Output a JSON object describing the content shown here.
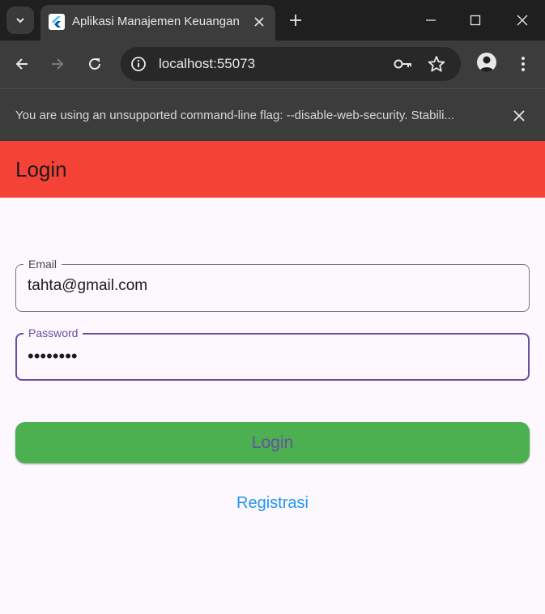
{
  "browser": {
    "tab": {
      "title": "Aplikasi Manajemen Keuangan",
      "favicon": "flutter-logo-icon"
    },
    "url": "localhost:55073",
    "infobar": {
      "message": "You are using an unsupported command-line flag: --disable-web-security. Stabili..."
    },
    "icons": [
      "tab-search-icon",
      "close-icon",
      "plus-icon",
      "minimize-icon",
      "maximize-icon",
      "back-icon",
      "forward-icon",
      "reload-icon",
      "info-icon",
      "key-icon",
      "star-icon",
      "profile-icon",
      "menu-icon"
    ]
  },
  "app": {
    "appbar_title": "Login",
    "email": {
      "label": "Email",
      "value": "tahta@gmail.com"
    },
    "password": {
      "label": "Password",
      "value": "••••••••"
    },
    "login_button": "Login",
    "register_link": "Registrasi"
  },
  "colors": {
    "appbar": "#f44336",
    "login_button": "#4caf50",
    "primary": "#6750a4",
    "link": "#2196f3",
    "background": "#fdf7fe"
  }
}
